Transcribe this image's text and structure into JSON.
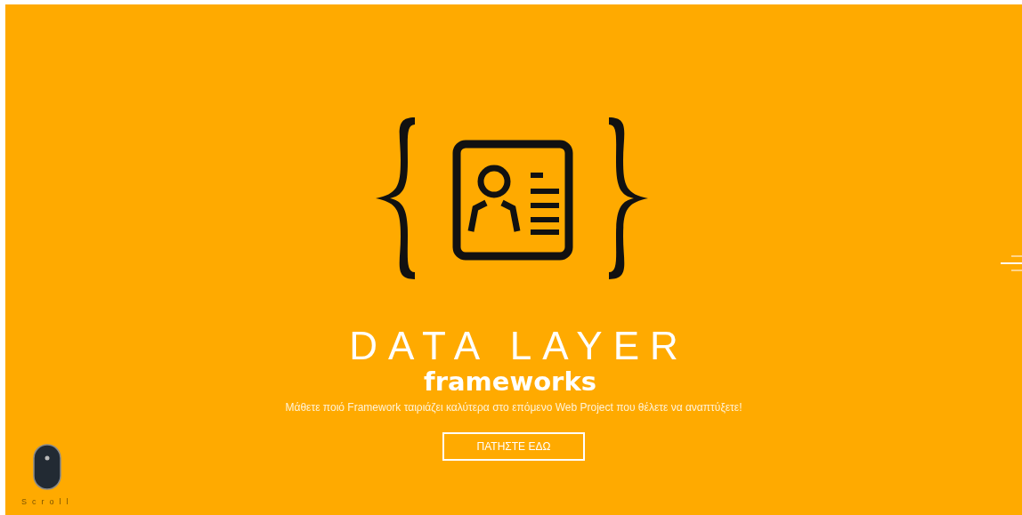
{
  "hero": {
    "title": "DATA LAYER",
    "subtitle": "frameworks",
    "tagline": "Μάθετε ποιό Framework ταιριάζει καλύτερα στο επόμενο Web Project που θέλετε να αναπτύξετε!",
    "button": "ΠΑΤΗΣΤΕ ΕΔΩ"
  },
  "scroll_hint": {
    "label": "Scroll"
  },
  "slide_nav": [
    {
      "selected": false
    },
    {
      "selected": true
    },
    {
      "selected": false
    }
  ]
}
